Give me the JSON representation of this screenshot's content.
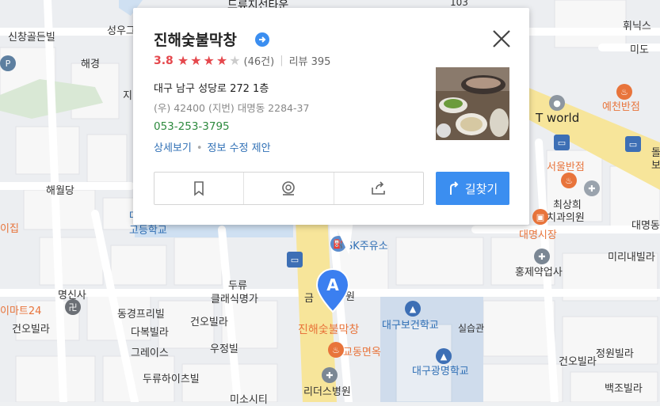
{
  "place": {
    "name": "진해숯불막창",
    "rating": "3.8",
    "stars_filled": 4,
    "stars_total": 5,
    "review_count": "(46건)",
    "blog_reviews": "리뷰 395",
    "address": "대구 남구 성당로 272 1층",
    "address_detail": "(우) 42400   (지번) 대명동 2284-37",
    "phone": "053-253-3795",
    "link_detail": "상세보기",
    "link_edit": "정보 수정 제안",
    "route_label": "길찾기"
  },
  "map": {
    "marker_letter": "A",
    "labels": {
      "top_road": "드류지선타운",
      "top_num": "103",
      "sinchang": "신창골든빌",
      "seongu": "성우그",
      "haegyeong": "해경",
      "ji": "지",
      "haewoldang": "해월당",
      "dae_school": "대",
      "godeung": "고등학교",
      "ijip": "이집",
      "myeongsinsa": "명신사",
      "emart24": "이마트24",
      "geonovilla_l": "건오빌라",
      "donggyeong": "동경프리빌",
      "dabok": "다복빌라",
      "greis": "그레이스",
      "duryu_height": "두류하이츠빌",
      "duryu": "두류",
      "classic": "클래식명가",
      "geonovilla_m": "건오빌라",
      "ujeong": "우정빌",
      "misocity": "미소시티",
      "sk": "SK주유소",
      "geum": "금",
      "won": "원",
      "jinhae_map": "진해숯불막창",
      "gyodong": "교동면옥",
      "daegu_bogeon": "대구보건학교",
      "silseupgwan": "실습관",
      "daegu_gwangmyeong": "대구광명학교",
      "rideoseu": "리더스병원",
      "twi": "휘닉스",
      "mido": "미도",
      "yecheon": "예천반점",
      "tworld": "T world",
      "seoul": "서울반점",
      "choisanghui": "최상희",
      "chigwa": "치과의원",
      "daemyeong_market": "대명시장",
      "daemyeong_r": "대명동",
      "hongje": "홍제약업사",
      "miri": "미리내빌라",
      "jeongwon": "정원빌라",
      "geonovilla_r": "건오빌라",
      "baekjo": "백조빌라",
      "dol": "돌",
      "bo": "보"
    }
  }
}
